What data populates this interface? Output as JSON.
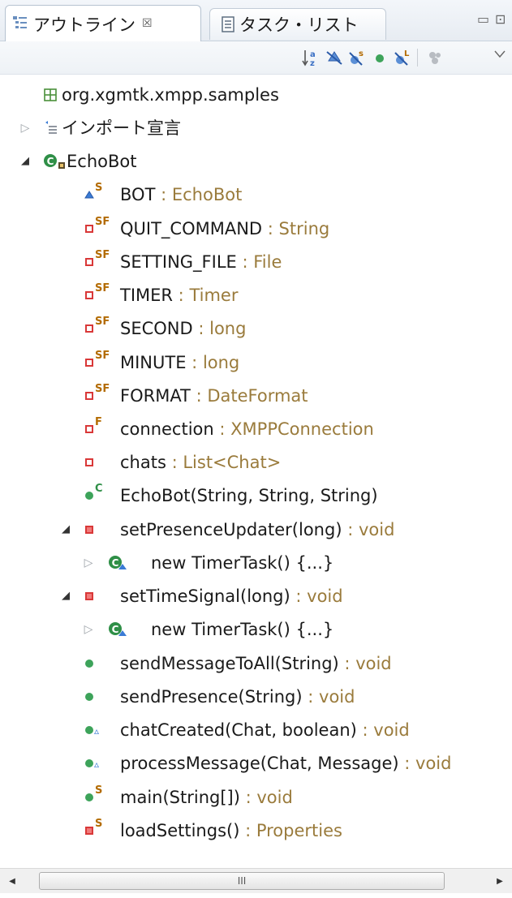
{
  "tabs": {
    "outline_label": "アウトライン",
    "outline_close": "☒",
    "tasks_label": "タスク・リスト"
  },
  "window_buttons": {
    "minimize": "▭",
    "maximize": "⊡"
  },
  "toolbar": {
    "buttons": [
      "sort-icon",
      "hide-fields-icon",
      "hide-static-icon",
      "hide-non-public-icon",
      "hide-local-types-icon",
      "view-menu-icon"
    ]
  },
  "tree": [
    {
      "name": "org.xgmtk.xmpp.samples",
      "type": "",
      "icon": "package-icon"
    },
    {
      "name": "インポート宣言",
      "type": "",
      "icon": "imports-icon",
      "toggle": "▷"
    },
    {
      "name": "EchoBot",
      "type": "",
      "icon": "class-icon",
      "toggle": "◢"
    },
    {
      "name": "BOT",
      "type": "EchoBot",
      "icon": "field-default-icon",
      "sup": "S"
    },
    {
      "name": "QUIT_COMMAND",
      "type": "String",
      "icon": "field-private-icon",
      "sup": "SF"
    },
    {
      "name": "SETTING_FILE",
      "type": "File",
      "icon": "field-private-icon",
      "sup": "SF"
    },
    {
      "name": "TIMER",
      "type": "Timer",
      "icon": "field-private-icon",
      "sup": "SF"
    },
    {
      "name": "SECOND",
      "type": "long",
      "icon": "field-private-icon",
      "sup": "SF"
    },
    {
      "name": "MINUTE",
      "type": "long",
      "icon": "field-private-icon",
      "sup": "SF"
    },
    {
      "name": "FORMAT",
      "type": "DateFormat",
      "icon": "field-private-icon",
      "sup": "SF"
    },
    {
      "name": "connection",
      "type": "XMPPConnection",
      "icon": "field-private-icon",
      "sup": "F"
    },
    {
      "name": "chats",
      "type": "List<Chat>",
      "icon": "field-private-icon",
      "sup": ""
    },
    {
      "name": "EchoBot(String, String, String)",
      "type": "",
      "icon": "constructor-icon",
      "sup": "C"
    },
    {
      "name": "setPresenceUpdater(long)",
      "type": "void",
      "icon": "method-private-icon",
      "sup": "",
      "toggle": "◢"
    },
    {
      "name": "new TimerTask() {...}",
      "type": "",
      "icon": "anonymous-class-icon",
      "toggle": "▷"
    },
    {
      "name": "setTimeSignal(long)",
      "type": "void",
      "icon": "method-private-icon",
      "sup": "",
      "toggle": "◢"
    },
    {
      "name": "new TimerTask() {...}",
      "type": "",
      "icon": "anonymous-class-icon",
      "toggle": "▷"
    },
    {
      "name": "sendMessageToAll(String)",
      "type": "void",
      "icon": "method-public-icon",
      "sup": ""
    },
    {
      "name": "sendPresence(String)",
      "type": "void",
      "icon": "method-public-icon",
      "sup": ""
    },
    {
      "name": "chatCreated(Chat, boolean)",
      "type": "void",
      "icon": "method-public-icon",
      "sup": "▵"
    },
    {
      "name": "processMessage(Chat, Message)",
      "type": "void",
      "icon": "method-public-icon",
      "sup": "▵"
    },
    {
      "name": "main(String[])",
      "type": "void",
      "icon": "method-public-icon",
      "sup": "S"
    },
    {
      "name": "loadSettings()",
      "type": "Properties",
      "icon": "method-private-icon",
      "sup": "S"
    }
  ],
  "type_separator": " : ",
  "scrollbar": {
    "thumb_grip": "III",
    "left_arrow": "◀",
    "right_arrow": "▶"
  },
  "colors": {
    "type_text": "#9a7b3c",
    "public_green": "#3da35a",
    "private_red": "#d93838",
    "package_green": "#4a8f3a",
    "class_green": "#2f8f47",
    "default_blue": "#3a7bd5",
    "sup_orange": "#b36b00"
  }
}
